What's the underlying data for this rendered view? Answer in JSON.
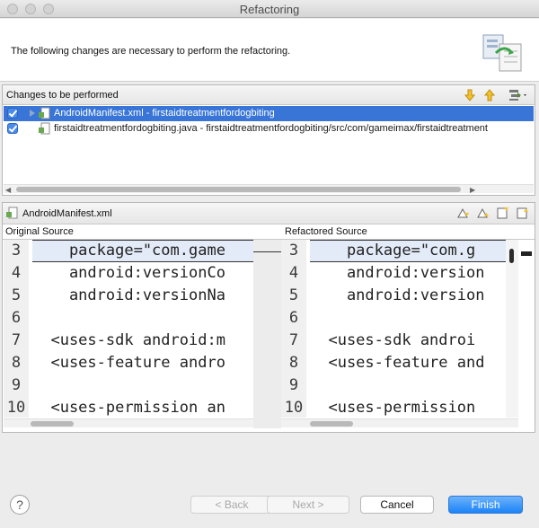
{
  "window": {
    "title": "Refactoring"
  },
  "banner": {
    "message": "The following changes are necessary to perform the refactoring."
  },
  "changes": {
    "header": "Changes to be performed",
    "items": [
      {
        "label": "AndroidManifest.xml - firstaidtreatmentfordogbiting",
        "checked": true,
        "selected": true
      },
      {
        "label": "firstaidtreatmentfordogbiting.java - firstaidtreatmentfordogbiting/src/com/gameimax/firstaidtreatment",
        "checked": true,
        "selected": false
      }
    ]
  },
  "preview": {
    "file_name": "AndroidManifest.xml",
    "original_label": "Original Source",
    "refactored_label": "Refactored Source",
    "original_lines": [
      {
        "num": "3",
        "text": "    package=\"com.game"
      },
      {
        "num": "4",
        "text": "    android:versionCo"
      },
      {
        "num": "5",
        "text": "    android:versionNa"
      },
      {
        "num": "6",
        "text": ""
      },
      {
        "num": "7",
        "text": "  <uses-sdk android:m"
      },
      {
        "num": "8",
        "text": "  <uses-feature andro"
      },
      {
        "num": "9",
        "text": ""
      },
      {
        "num": "10",
        "text": "  <uses-permission an"
      }
    ],
    "refactored_lines": [
      {
        "num": "3",
        "text": "    package=\"com.g"
      },
      {
        "num": "4",
        "text": "    android:version"
      },
      {
        "num": "5",
        "text": "    android:version"
      },
      {
        "num": "6",
        "text": ""
      },
      {
        "num": "7",
        "text": "  <uses-sdk androi"
      },
      {
        "num": "8",
        "text": "  <uses-feature and"
      },
      {
        "num": "9",
        "text": ""
      },
      {
        "num": "10",
        "text": "  <uses-permission"
      }
    ]
  },
  "buttons": {
    "help": "?",
    "back": "< Back",
    "next": "Next >",
    "cancel": "Cancel",
    "finish": "Finish"
  },
  "icons": {
    "banner": "refactoring-wizard-icon",
    "next_change": "arrow-down-icon",
    "prev_change": "arrow-up-icon",
    "filter": "filter-menu-icon",
    "file": "xml-file-icon"
  },
  "colors": {
    "selection": "#3875d7",
    "primary_button": "#1c83f8",
    "highlight_line": "#e4ebf8"
  }
}
